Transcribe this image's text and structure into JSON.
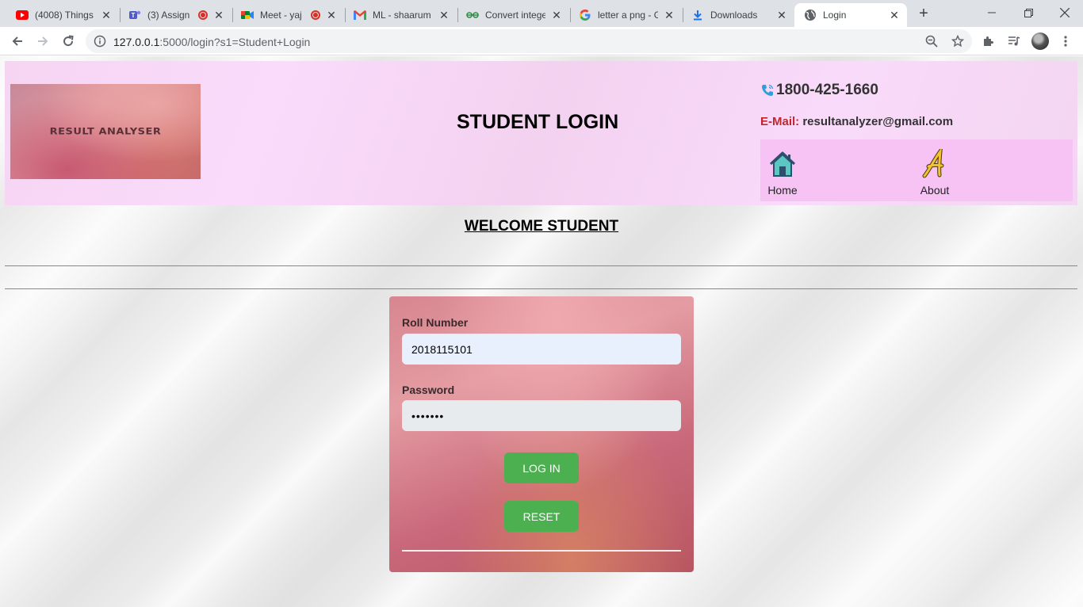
{
  "browser": {
    "tabs": [
      {
        "title": "(4008) Things",
        "icon": "youtube-icon",
        "recording": false
      },
      {
        "title": "(3) Assign",
        "icon": "teams-icon",
        "recording": true
      },
      {
        "title": "Meet - yaj",
        "icon": "meet-icon",
        "recording": true
      },
      {
        "title": "ML - shaarum",
        "icon": "gmail-icon",
        "recording": false
      },
      {
        "title": "Convert intege",
        "icon": "geeksforgeeks-icon",
        "recording": false
      },
      {
        "title": "letter a png - G",
        "icon": "google-icon",
        "recording": false
      },
      {
        "title": "Downloads",
        "icon": "download-icon",
        "recording": false
      },
      {
        "title": "Login",
        "icon": "globe-icon",
        "recording": false,
        "active": true
      }
    ],
    "url_host": "127.0.0.1",
    "url_rest": ":5000/login?s1=Student+Login"
  },
  "header": {
    "logo_text": "RESULT ANALYSER",
    "title": "STUDENT LOGIN",
    "phone": "1800-425-1660",
    "email_label": "E-Mail:",
    "email": "resultanalyzer@gmail.com",
    "nav": [
      {
        "label": "Home",
        "icon": "home-icon"
      },
      {
        "label": "About",
        "icon": "letter-a-icon"
      }
    ]
  },
  "main": {
    "welcome": "WELCOME STUDENT",
    "form": {
      "roll_label": "Roll Number",
      "roll_value": "2018115101",
      "password_label": "Password",
      "password_value": "•••••••",
      "login_button": "LOG IN",
      "reset_button": "RESET"
    }
  },
  "colors": {
    "header_bg": "#f9dafa",
    "nav_bg": "#f6c3f4",
    "button_green": "#4caf50",
    "email_label_red": "#c0262e"
  }
}
